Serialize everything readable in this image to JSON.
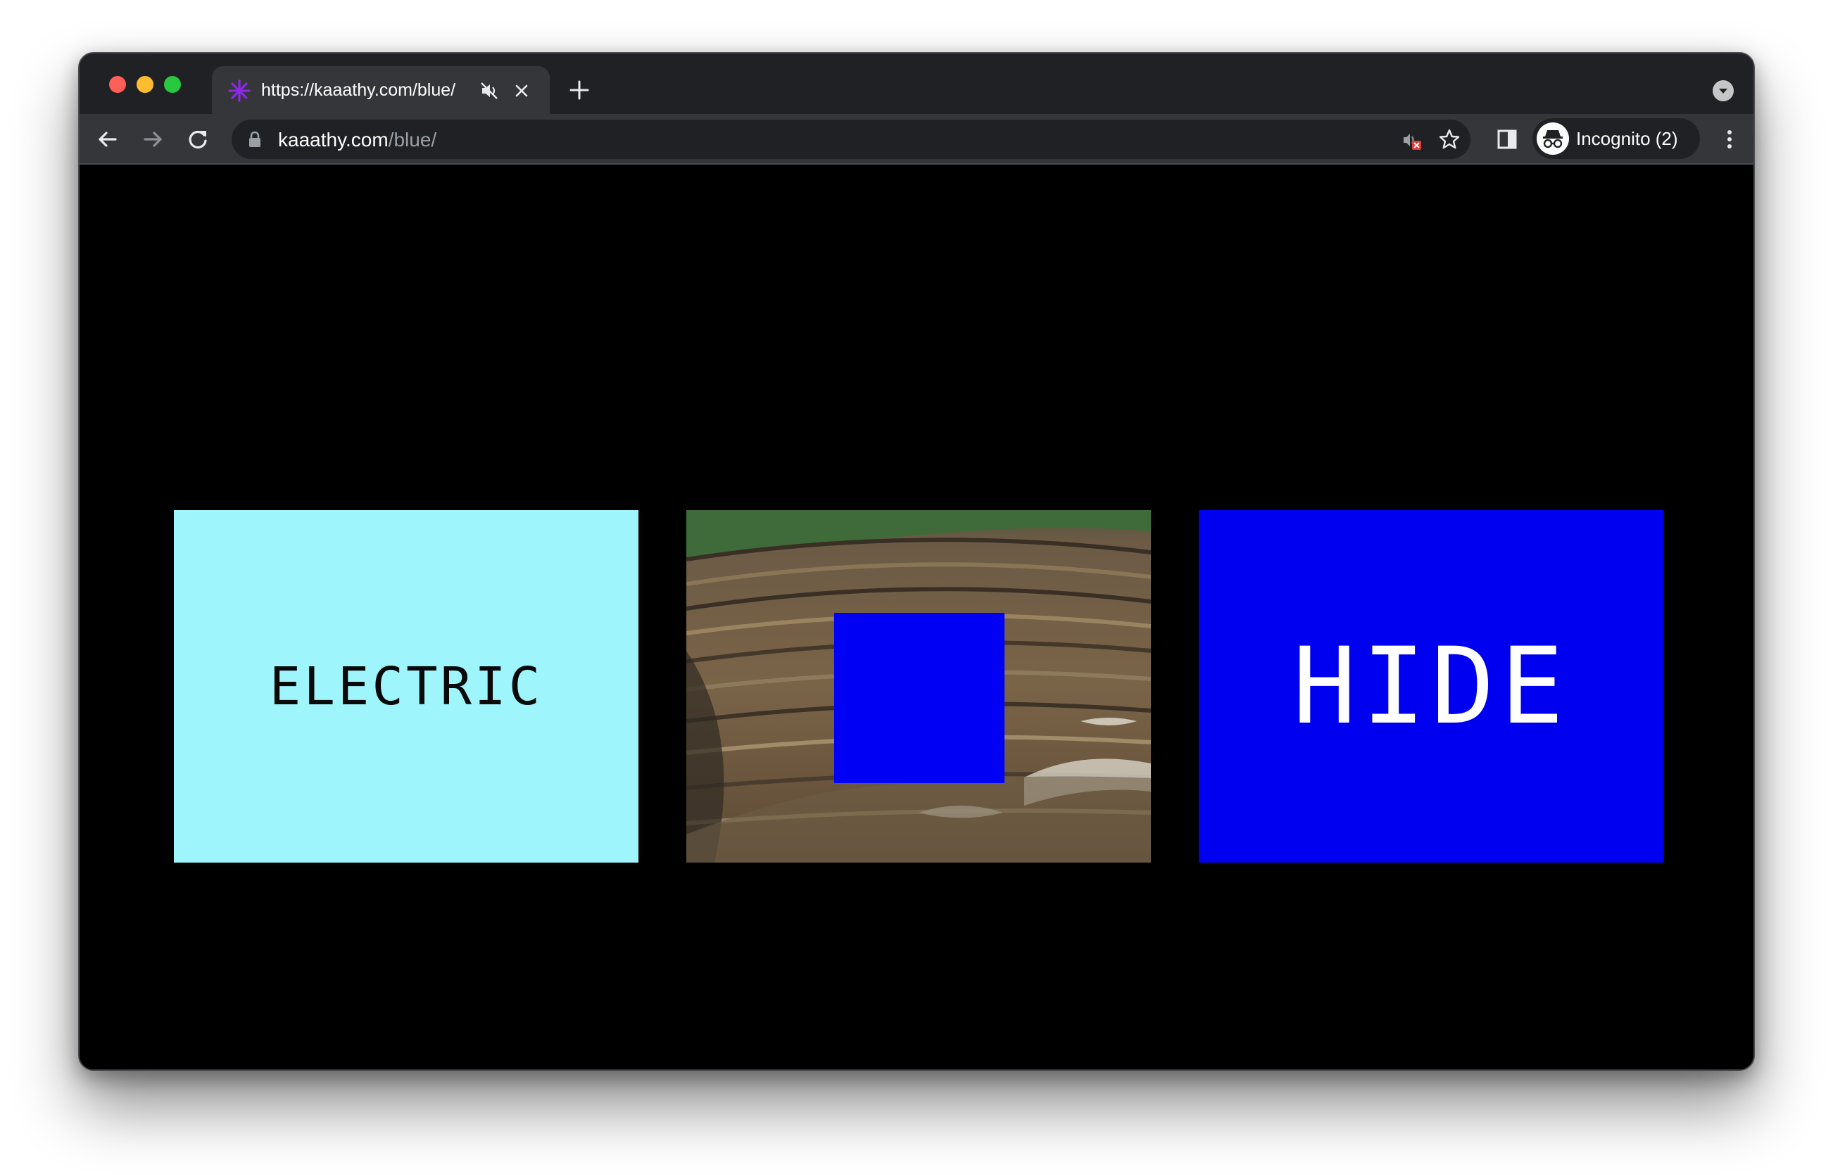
{
  "browser": {
    "tab": {
      "title": "https://kaaathy.com/blue/",
      "favicon": "asterisk-icon",
      "favicon_color": "#8a2be2"
    },
    "address_bar": {
      "domain": "kaaathy.com",
      "path": "/blue/"
    },
    "profile": {
      "label": "Incognito (2)"
    },
    "icons": {
      "back": "back-arrow-icon",
      "forward": "forward-arrow-icon",
      "reload": "reload-icon",
      "lock": "lock-icon",
      "sound_blocked": "sound-blocked-icon",
      "bookmark": "star-icon",
      "side_panel": "side-panel-icon",
      "menu": "kebab-menu-icon",
      "tab_search": "tab-search-icon",
      "new_tab": "plus-icon",
      "mute": "muted-speaker-icon",
      "close": "close-icon"
    }
  },
  "page": {
    "background": "#000000",
    "cards": [
      {
        "type": "text",
        "text": "ELECTRIC",
        "background": "#9ef5fc",
        "text_color": "#0a0a0a"
      },
      {
        "type": "image",
        "description_name": "open-pit-mine-photo",
        "overlay_color": "#0000f5"
      },
      {
        "type": "text",
        "text": "HIDE",
        "background": "#0000f0",
        "text_color": "#ffffff"
      }
    ]
  }
}
